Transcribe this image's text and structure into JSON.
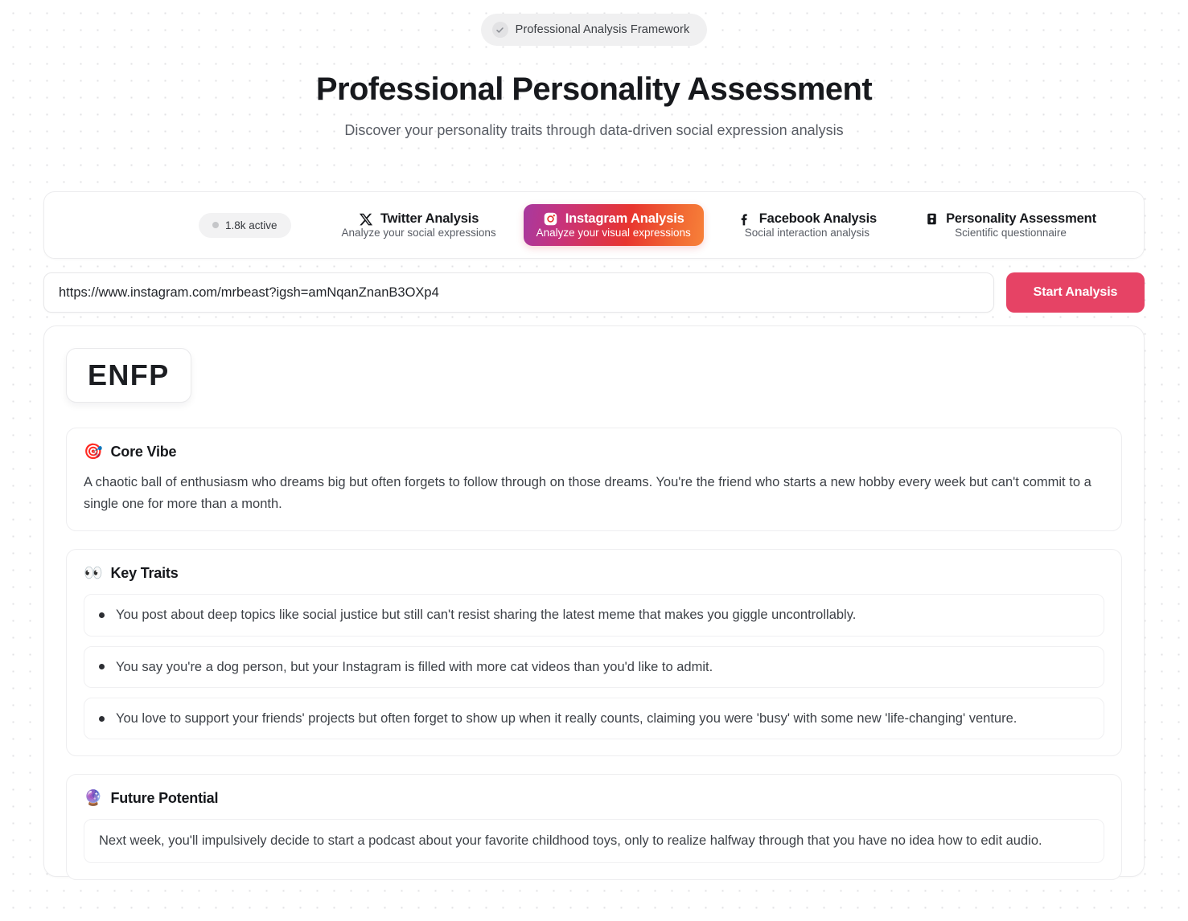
{
  "header": {
    "badge_label": "Professional Analysis Framework",
    "badge_icon": "check-icon",
    "title": "Professional Personality Assessment",
    "subtitle": "Discover your personality traits through data-driven social expression analysis"
  },
  "selector": {
    "active_count_label": "1.8k active",
    "tabs": [
      {
        "id": "twitter",
        "icon": "twitter-x-icon",
        "label": "Twitter Analysis",
        "sublabel": "Analyze your social expressions",
        "active": false
      },
      {
        "id": "instagram",
        "icon": "instagram-icon",
        "label": "Instagram Analysis",
        "sublabel": "Analyze your visual expressions",
        "active": true
      },
      {
        "id": "facebook",
        "icon": "facebook-icon",
        "label": "Facebook Analysis",
        "sublabel": "Social interaction analysis",
        "active": false
      },
      {
        "id": "personality",
        "icon": "clipboard-icon",
        "label": "Personality Assessment",
        "sublabel": "Scientific questionnaire",
        "active": false
      }
    ]
  },
  "url_row": {
    "value": "https://www.instagram.com/mrbeast?igsh=amNqanZnanB3OXp4",
    "placeholder": "Enter profile URL",
    "button_label": "Start Analysis"
  },
  "results": {
    "type_badge": "ENFP",
    "core_vibe": {
      "emoji": "🎯",
      "icon": "dart-target-icon",
      "title": "Core Vibe",
      "body": "A chaotic ball of enthusiasm who dreams big but often forgets to follow through on those dreams. You're the friend who starts a new hobby every week but can't commit to a single one for more than a month."
    },
    "key_traits": {
      "emoji": "👀",
      "icon": "eyes-icon",
      "title": "Key Traits",
      "items": [
        "You post about deep topics like social justice but still can't resist sharing the latest meme that makes you giggle uncontrollably.",
        "You say you're a dog person, but your Instagram is filled with more cat videos than you'd like to admit.",
        "You love to support your friends' projects but often forget to show up when it really counts, claiming you were 'busy' with some new 'life-changing' venture."
      ]
    },
    "future_potential": {
      "emoji": "🔮",
      "icon": "crystal-ball-icon",
      "title": "Future Potential",
      "body": "Next week, you'll impulsively decide to start a podcast about your favorite childhood toys, only to realize halfway through that you have no idea how to edit audio."
    }
  },
  "colors": {
    "accent_button": "#e64365",
    "instagram_gradient_start": "#a7399f",
    "instagram_gradient_mid": "#e8352f",
    "instagram_gradient_end": "#f7813a",
    "page_background": "#ffffff",
    "dot_grid": "#e2e2e4"
  }
}
